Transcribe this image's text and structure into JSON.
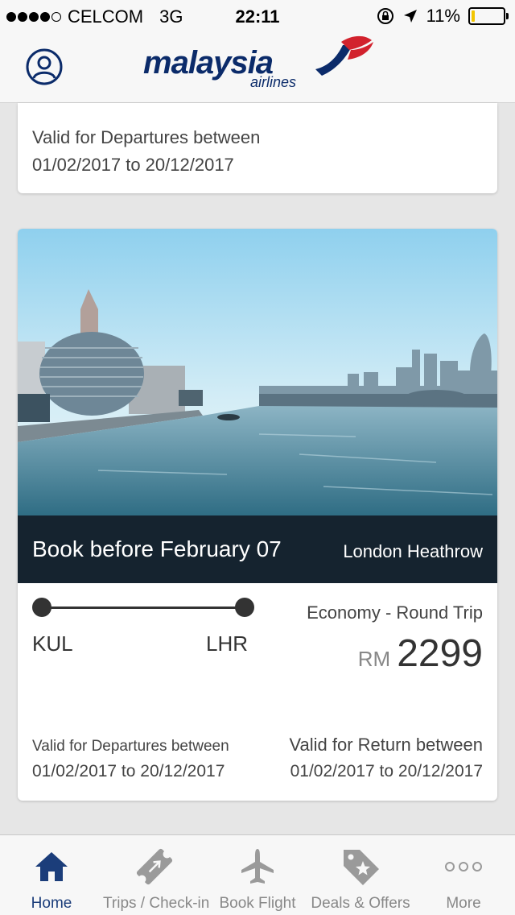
{
  "status_bar": {
    "carrier": "CELCOM",
    "network": "3G",
    "time": "22:11",
    "battery": "11%",
    "battery_level": 0.11
  },
  "header": {
    "logo_text": "malaysia",
    "logo_sub": "airlines"
  },
  "card_top": {
    "valid_label": "Valid for Departures between",
    "valid_dates": "01/02/2017 to 20/12/2017"
  },
  "deal": {
    "image": "london-thames-skyline",
    "title": "Book before February 07",
    "destination": "London Heathrow",
    "from": "KUL",
    "to": "LHR",
    "cabin": "Economy - Round Trip",
    "currency": "RM",
    "price": "2299",
    "departure_label": "Valid for Departures between",
    "departure_dates": "01/02/2017 to 20/12/2017",
    "return_label": "Valid for Return between",
    "return_dates": "01/02/2017 to 20/12/2017"
  },
  "tabs": [
    {
      "label": "Home",
      "icon": "home-icon",
      "active": true
    },
    {
      "label": "Trips / Check-in",
      "icon": "ticket-icon",
      "active": false
    },
    {
      "label": "Book Flight",
      "icon": "plane-icon",
      "active": false
    },
    {
      "label": "Deals & Offers",
      "icon": "tag-star-icon",
      "active": false
    },
    {
      "label": "More",
      "icon": "more-dots-icon",
      "active": false
    }
  ],
  "colors": {
    "brand_navy": "#0b2b6a",
    "brand_red": "#d2222d",
    "active_tab": "#1b3d7a",
    "inactive_tab": "#888888"
  }
}
